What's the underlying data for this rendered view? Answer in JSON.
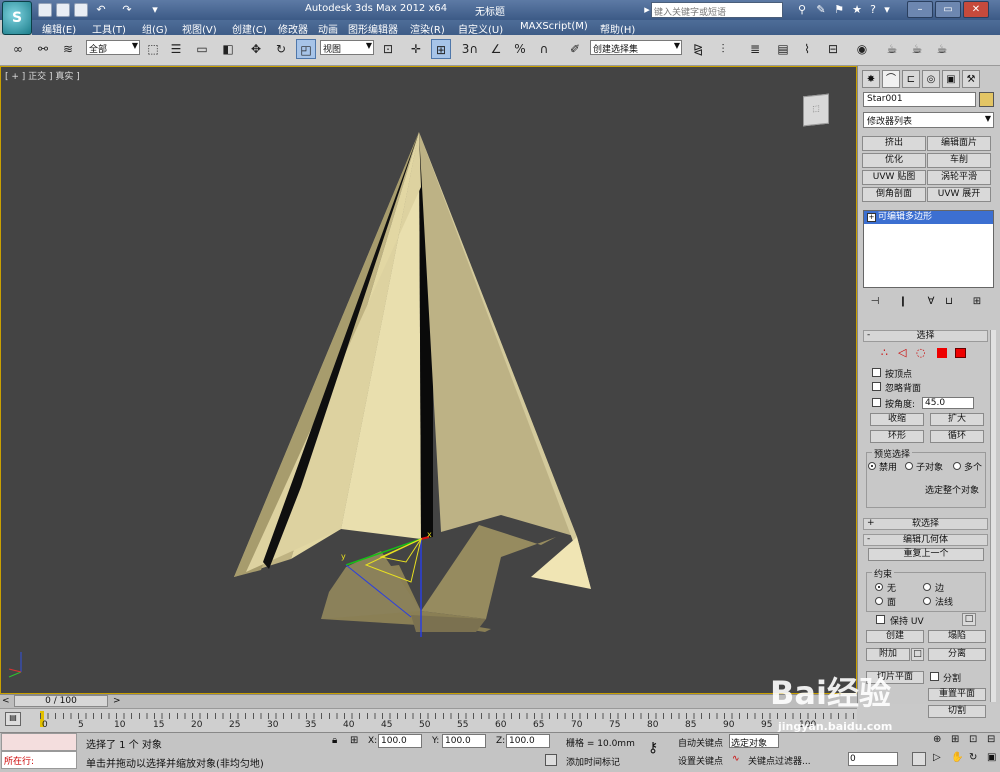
{
  "title_bar": {
    "app_title": "Autodesk 3ds Max  2012 x64",
    "doc_title": "无标题",
    "search_placeholder": "键入关键字或短语"
  },
  "menu": [
    "编辑(E)",
    "工具(T)",
    "组(G)",
    "视图(V)",
    "创建(C)",
    "修改器",
    "动画",
    "图形编辑器",
    "渲染(R)",
    "自定义(U)",
    "MAXScript(M)",
    "帮助(H)"
  ],
  "toolbar": {
    "filter_value": "全部",
    "ref_coord_value": "视图",
    "selection_set_value": "创建选择集",
    "snap_label": "3"
  },
  "viewport": {
    "label": "[ + ] 正交 ] 真实 ]"
  },
  "command_panel": {
    "object_name": "Star001",
    "object_color": "#e3c565",
    "modifier_list": "修改器列表",
    "modifier_buttons": [
      "挤出",
      "编辑面片",
      "优化",
      "车削",
      "UVW 贴图",
      "涡轮平滑",
      "倒角剖面",
      "UVW 展开"
    ],
    "stack_item": "可编辑多边形",
    "selection": {
      "title": "选择",
      "by_vertex": "按顶点",
      "ignore_backfacing": "忽略背面",
      "by_angle": "按角度:",
      "angle_value": "45.0",
      "shrink": "收缩",
      "grow": "扩大",
      "ring": "环形",
      "loop": "循环",
      "preview_title": "预览选择",
      "preview_off": "禁用",
      "preview_subobj": "子对象",
      "preview_multi": "多个",
      "whole_object": "选定整个对象"
    },
    "soft_selection": "软选择",
    "edit_geometry": {
      "title": "编辑几何体",
      "repeat_last": "重复上一个",
      "constraints": "约束",
      "none": "无",
      "edge": "边",
      "face": "面",
      "normal": "法线",
      "preserve_uv": "保持 UV",
      "create": "创建",
      "collapse": "塌陷",
      "attach": "附加",
      "detach": "分离",
      "slice_plane": "切片平面",
      "split": "分割",
      "reset_plane": "重置平面",
      "cut": "切割"
    }
  },
  "timeline": {
    "frame_display": "0 / 100",
    "ticks": [
      "0",
      "5",
      "10",
      "15",
      "20",
      "25",
      "30",
      "35",
      "40",
      "45",
      "50",
      "55",
      "60",
      "65",
      "70",
      "75",
      "80",
      "85",
      "90",
      "95",
      "100"
    ]
  },
  "status": {
    "maxscript_label": "所在行:",
    "selected_text": "选择了 1 个 对象",
    "prompt_text": "单击并拖动以选择并缩放对象(非均匀地)",
    "x_label": "X:",
    "x_value": "100.0",
    "y_label": "Y:",
    "y_value": "100.0",
    "z_label": "Z:",
    "z_value": "100.0",
    "grid": "栅格 = 10.0mm",
    "add_time_tag": "添加时间标记",
    "auto_key": "自动关键点",
    "set_key": "设置关键点",
    "selected_obj": "选定对象",
    "key_filters": "关键点过滤器...",
    "frame_value": "0"
  },
  "watermark": {
    "brand": "Bai经验",
    "url": "jingyan.baidu.com"
  }
}
